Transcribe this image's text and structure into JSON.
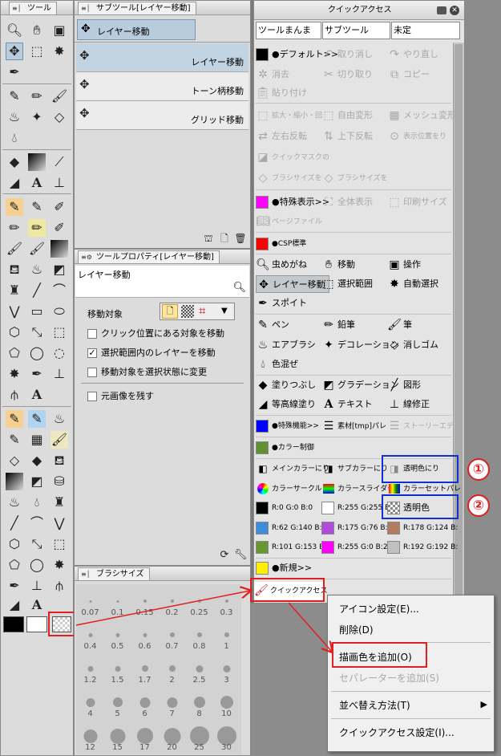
{
  "tool_panel": {
    "title": "ツール",
    "icons": [
      "magnifier-icon",
      "hand-icon",
      "rotate-view-icon",
      "move-layer-icon",
      "rect-select-icon",
      "magic-wand-icon",
      "eyedropper-icon",
      "pen-icon",
      "pen-alt-icon",
      "brush-icon",
      "airbrush-icon",
      "decoration-icon",
      "eraser-icon",
      "blend-icon",
      "fill-icon",
      "gradient-icon",
      "figure-icon",
      "contour-fill-icon",
      "text-icon",
      "line-correct-icon"
    ]
  },
  "subtool_panel": {
    "title": "サブツール[レイヤー移動]",
    "group_label": "レイヤー移動",
    "items": [
      "レイヤー移動",
      "トーン柄移動",
      "グリッド移動"
    ]
  },
  "tool_property": {
    "title": "ツールプロパティ[レイヤー移動]",
    "tool_name": "レイヤー移動",
    "move_target_label": "移動対象",
    "options": [
      {
        "label": "クリック位置にある対象を移動",
        "checked": false
      },
      {
        "label": "選択範囲内のレイヤーを移動",
        "checked": true
      },
      {
        "label": "移動対象を選択状態に変更",
        "checked": false
      }
    ],
    "keep_original": {
      "label": "元画像を残す",
      "checked": false
    }
  },
  "brush_size": {
    "title": "ブラシサイズ",
    "sizes": [
      "0.07",
      "0.1",
      "0.15",
      "0.2",
      "0.25",
      "0.3",
      "0.4",
      "0.5",
      "0.6",
      "0.7",
      "0.8",
      "1",
      "1.2",
      "1.5",
      "1.7",
      "2",
      "2.5",
      "3",
      "4",
      "5",
      "6",
      "7",
      "8",
      "10",
      "12",
      "15",
      "17",
      "20",
      "25",
      "30"
    ]
  },
  "colors": {
    "main": "#000000",
    "sub": "#ffffff"
  },
  "quick_access": {
    "title": "クイックアクセス",
    "tabs": [
      "ツールまんま",
      "サブツール",
      "未定"
    ],
    "rows": {
      "r1": [
        "●デフォルト>>",
        "取り消し",
        "やり直し"
      ],
      "r2": [
        "消去",
        "切り取り",
        "コピー"
      ],
      "r3": [
        "貼り付け"
      ],
      "r4": [
        "拡大・縮小・回",
        "自由変形",
        "メッシュ変形"
      ],
      "r5": [
        "左右反転",
        "上下反転",
        "表示位置をり"
      ],
      "r6": [
        "クイックマスクの"
      ],
      "r7": [
        "ブラシサイズを",
        "ブラシサイズを"
      ],
      "r8": [
        "●特殊表示>>",
        "全体表示",
        "印刷サイズ"
      ],
      "r9": [
        "ページファイル"
      ],
      "r10": [
        "●CSP標準"
      ],
      "r11": [
        "虫めがね",
        "移動",
        "操作"
      ],
      "r12": [
        "レイヤー移動",
        "選択範囲",
        "自動選択"
      ],
      "r13": [
        "スポイト"
      ],
      "r14": [
        "ペン",
        "鉛筆",
        "筆"
      ],
      "r15": [
        "エアブラシ",
        "デコレーション",
        "消しゴム"
      ],
      "r16": [
        "色混ぜ"
      ],
      "r17": [
        "塗りつぶし",
        "グラデーション",
        "図形"
      ],
      "r18": [
        "等高線塗り",
        "テキスト",
        "線修正"
      ],
      "r19": [
        "●特殊機能>>",
        "素材[tmp]パレ",
        "ストーリーエディ"
      ],
      "r20": [
        "●カラー制御"
      ],
      "r21": [
        "メインカラーにり",
        "サブカラーにり",
        "透明色にり"
      ],
      "r22": [
        "カラーサークル",
        "カラースライダー",
        "カラーセットパレ"
      ],
      "r23": [
        "R:0 G:0 B:0",
        "R:255 G:255 B:2",
        "透明色"
      ],
      "r24": [
        "R:62 G:140 B:2",
        "R:175 G:76 B:2",
        "R:178 G:124 B:"
      ],
      "r25": [
        "R:101 G:153 B:",
        "R:255 G:0 B:22",
        "R:192 G:192 B:"
      ],
      "r26": [
        "●新規>>"
      ],
      "r27": [
        "クイックアクセス"
      ]
    },
    "swatches": {
      "default": "#000000",
      "special": "#ff00ff",
      "csp": "#ff0000",
      "special_func": "#0000ff",
      "color_ctrl": "#609030",
      "c1": "#000000",
      "c2": "#ffffff",
      "c3": "#3e8cdc",
      "c4": "#af4cdc",
      "c5": "#b27c60",
      "c6": "#659930",
      "c7": "#ff00ff",
      "c8": "#c0c0c0",
      "new": "#ffee00"
    }
  },
  "context_menu": {
    "items": [
      "アイコン設定(E)...",
      "削除(D)",
      "描画色を追加(O)",
      "セパレーターを追加(S)",
      "並べ替え方法(T)",
      "クイックアクセス設定(I)..."
    ],
    "submenu_arrow": "▶"
  },
  "annotations": {
    "one": "①",
    "two": "②"
  }
}
